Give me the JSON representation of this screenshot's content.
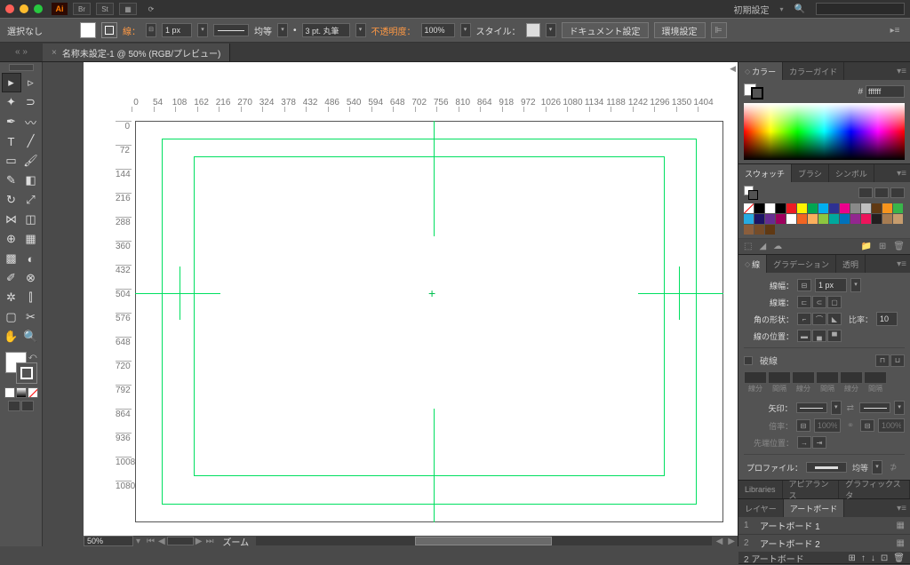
{
  "titlebar": {
    "preset": "初期設定",
    "ai": "Ai",
    "br": "Br",
    "st": "St"
  },
  "control": {
    "selection": "選択なし",
    "stroke_label": "線：",
    "stroke_width": "1 px",
    "uniform": "均等",
    "brush": "3 pt. 丸筆",
    "opacity_label": "不透明度：",
    "opacity": "100%",
    "style_label": "スタイル：",
    "doc_setup": "ドキュメント設定",
    "env_setup": "環境設定"
  },
  "doctab": {
    "title": "名称未設定-1 @ 50% (RGB/プレビュー)"
  },
  "ruler_h": [
    "0",
    "54",
    "108",
    "162",
    "216",
    "270",
    "324",
    "378",
    "432",
    "486",
    "540",
    "594",
    "648",
    "702",
    "756",
    "810",
    "864",
    "918",
    "972",
    "1026",
    "1080",
    "1134",
    "1188",
    "1242",
    "1296",
    "1350",
    "1404"
  ],
  "ruler_v": [
    "0",
    "72",
    "144",
    "216",
    "288",
    "360",
    "432",
    "504",
    "576",
    "648",
    "720",
    "792",
    "864",
    "936",
    "1008",
    "1080"
  ],
  "status": {
    "zoom": "50%",
    "zoom_label": "ズーム"
  },
  "panels": {
    "color": {
      "tab1": "カラー",
      "tab2": "カラーガイド",
      "hex": "ffffff",
      "hash": "#"
    },
    "swatch": {
      "tab1": "スウォッチ",
      "tab2": "ブラシ",
      "tab3": "シンボル"
    },
    "stroke": {
      "tab1": "線",
      "tab2": "グラデーション",
      "tab3": "透明",
      "width_label": "線幅：",
      "width": "1 px",
      "cap_label": "線端：",
      "corner_label": "角の形状：",
      "ratio_label": "比率：",
      "ratio": "10",
      "align_label": "線の位置：",
      "dash_label": "破線",
      "dash_cols": [
        "線分",
        "間隔",
        "線分",
        "間隔",
        "線分",
        "間隔"
      ],
      "arrow_label": "矢印：",
      "scale_label": "倍率：",
      "scale1": "100%",
      "scale2": "100%",
      "tip_label": "先端位置：",
      "profile_label": "プロファイル：",
      "profile": "均等"
    },
    "libs": {
      "tab1": "Libraries",
      "tab2": "アピアランス",
      "tab3": "グラフィックスタ"
    },
    "layers": {
      "tab1": "レイヤー",
      "tab2": "アートボード",
      "rows": [
        {
          "n": "1",
          "name": "アートボード 1"
        },
        {
          "n": "2",
          "name": "アートボード 2"
        }
      ],
      "footer": "2 アートボード"
    }
  },
  "swatch_colors": [
    "#fff",
    "#000",
    "#ed1c24",
    "#fff200",
    "#00a651",
    "#00aeef",
    "#2e3192",
    "#ec008c",
    "#898989",
    "#c0c0c0",
    "#603913",
    "#f7941d",
    "#39b54a",
    "#27aae1",
    "#1b1464",
    "#662d91",
    "#9e005d",
    "#ffffff",
    "#f26522",
    "#fbaf5d",
    "#8dc63f",
    "#00a99d",
    "#0072bc",
    "#92278f",
    "#ed145b",
    "#231f20",
    "#a67c52",
    "#c69c6d",
    "#8b5e3c",
    "#754c29",
    "#603913"
  ]
}
